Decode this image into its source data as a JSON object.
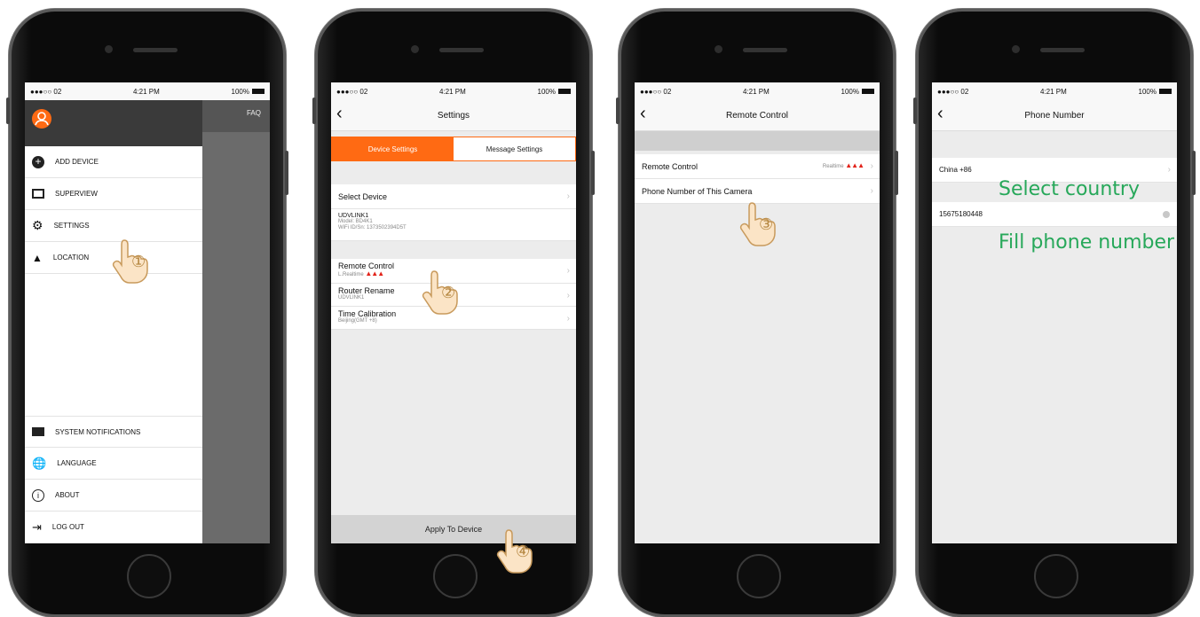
{
  "status_bar": {
    "carrier": "●●●○○ 02",
    "time": "4:21 PM",
    "battery": "100%"
  },
  "screen1": {
    "faq_label": "FAQ",
    "menu_items": [
      {
        "label": "ADD DEVICE",
        "icon": "add-circle-icon"
      },
      {
        "label": "SUPERVIEW",
        "icon": "image-icon"
      },
      {
        "label": "SETTINGS",
        "icon": "gear-icon"
      },
      {
        "label": "LOCATION",
        "icon": "location-icon"
      }
    ],
    "bottom_items": [
      {
        "label": "SYSTEM NOTIFICATIONS",
        "icon": "mail-icon"
      },
      {
        "label": "LANGUAGE",
        "icon": "globe-icon"
      },
      {
        "label": "ABOUT",
        "icon": "info-icon"
      },
      {
        "label": "LOG OUT",
        "icon": "logout-icon"
      }
    ],
    "step_label": "①"
  },
  "screen2": {
    "title": "Settings",
    "tab_device": "Device Settings",
    "tab_message": "Message Settings",
    "select_device": "Select Device",
    "device_name": "UDVLINK1",
    "device_model": "Model: BD4K1",
    "device_serial": "WiFi ID/Sn: 1373502394D5T",
    "remote_control": "Remote Control",
    "remote_sub": "L.Realtime",
    "router_rename": "Router Rename",
    "router_sub": "UDVLINK1",
    "time_calibration": "Time Calibration",
    "time_sub": "Beijing(GMT +8)",
    "apply_button": "Apply To Device",
    "step2": "②",
    "step4": "④"
  },
  "screen3": {
    "title": "Remote Control",
    "remote_control": "Remote Control",
    "remote_value": "Realtime",
    "phone_number": "Phone Number of This Camera",
    "step_label": "③"
  },
  "screen4": {
    "title": "Phone Number",
    "country": "China +86",
    "phone_value": "15675180448",
    "select_country_note": "Select country",
    "fill_phone_note": "Fill phone number"
  },
  "colors": {
    "accent": "#ff6a13",
    "warning": "#e2231a",
    "annotation": "#27a85a"
  }
}
